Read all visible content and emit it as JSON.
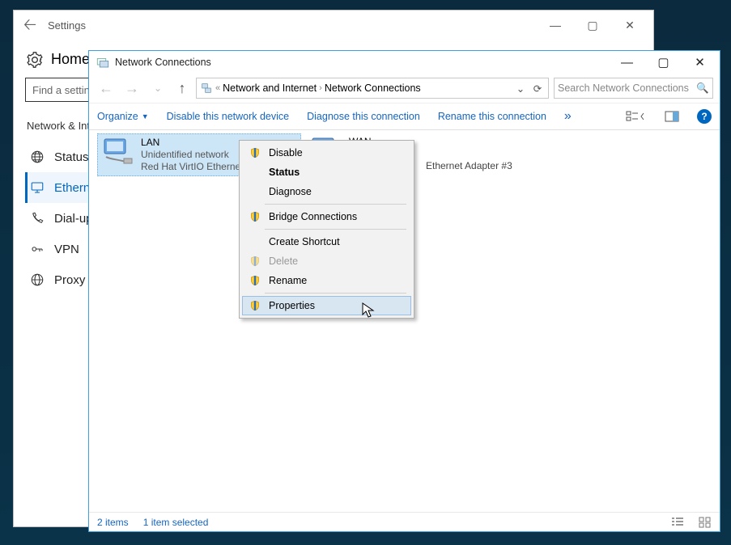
{
  "settings": {
    "title": "Settings",
    "home": "Home",
    "search_placeholder": "Find a setting",
    "section": "Network & Internet",
    "nav": {
      "status": "Status",
      "ethernet": "Ethernet",
      "dialup": "Dial-up",
      "vpn": "VPN",
      "proxy": "Proxy"
    }
  },
  "nc": {
    "title": "Network Connections",
    "breadcrumb": {
      "p1": "Network and Internet",
      "p2": "Network Connections"
    },
    "search_placeholder": "Search Network Connections",
    "toolbar": {
      "organize": "Organize",
      "disable": "Disable this network device",
      "diagnose": "Diagnose this connection",
      "rename": "Rename this connection"
    },
    "adapters": {
      "lan": {
        "name": "LAN",
        "sub": "Unidentified network",
        "dev": "Red Hat VirtIO Ethernet Adapter"
      },
      "wan": {
        "name": "WAN",
        "sub_visible": "Ethernet Adapter #3"
      }
    },
    "ctx": {
      "disable": "Disable",
      "status": "Status",
      "diagnose": "Diagnose",
      "bridge": "Bridge Connections",
      "shortcut": "Create Shortcut",
      "delete": "Delete",
      "rename": "Rename",
      "properties": "Properties"
    },
    "status": {
      "items": "2 items",
      "selected": "1 item selected"
    }
  }
}
